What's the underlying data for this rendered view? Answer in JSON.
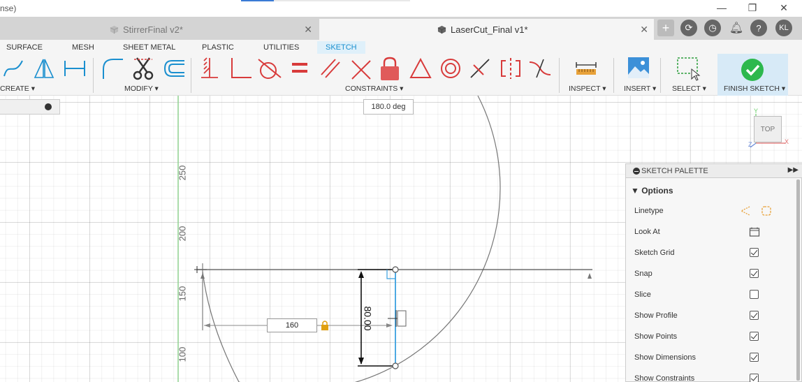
{
  "window": {
    "title_fragment": "nse)",
    "minimize": "—",
    "maximize": "❐",
    "close": "✕"
  },
  "tabs": [
    {
      "label": "StirrerFinal v2*",
      "active": false
    },
    {
      "label": "LaserCut_Final v1*",
      "active": true
    }
  ],
  "toolbar_right": {
    "add": "+",
    "user_initials": "KL",
    "help": "?"
  },
  "workspace_tabs": [
    "SURFACE",
    "MESH",
    "SHEET METAL",
    "PLASTIC",
    "UTILITIES",
    "SKETCH"
  ],
  "active_workspace": "SKETCH",
  "groups": {
    "create": "CREATE ▾",
    "modify": "MODIFY ▾",
    "constraints": "CONSTRAINTS ▾",
    "inspect": "INSPECT ▾",
    "insert": "INSERT ▾",
    "select": "SELECT ▾",
    "finish": "FINISH SKETCH ▾"
  },
  "canvas": {
    "angle_readout": "180.0 deg",
    "axis_labels": [
      "250",
      "200",
      "150",
      "100"
    ],
    "dimension_input": "160",
    "vertical_dimension": "80.00",
    "viewcube_face": "TOP",
    "axes": {
      "y": "Y",
      "x": "X",
      "z": "Z"
    }
  },
  "palette": {
    "title": "SKETCH PALETTE",
    "section": "▼ Options",
    "rows": [
      {
        "label": "Linetype",
        "kind": "icons"
      },
      {
        "label": "Look At",
        "kind": "icon"
      },
      {
        "label": "Sketch Grid",
        "kind": "check",
        "checked": true
      },
      {
        "label": "Snap",
        "kind": "check",
        "checked": true
      },
      {
        "label": "Slice",
        "kind": "check",
        "checked": false
      },
      {
        "label": "Show Profile",
        "kind": "check",
        "checked": true
      },
      {
        "label": "Show Points",
        "kind": "check",
        "checked": true
      },
      {
        "label": "Show Dimensions",
        "kind": "check",
        "checked": true
      },
      {
        "label": "Show Constraints",
        "kind": "check",
        "checked": true
      }
    ]
  },
  "colors": {
    "accent": "#1a8fcf",
    "constraint_red": "#d83b3b",
    "finish_green": "#2db84d",
    "sketch_line": "#555555",
    "selected_line": "#3aa0e0"
  }
}
